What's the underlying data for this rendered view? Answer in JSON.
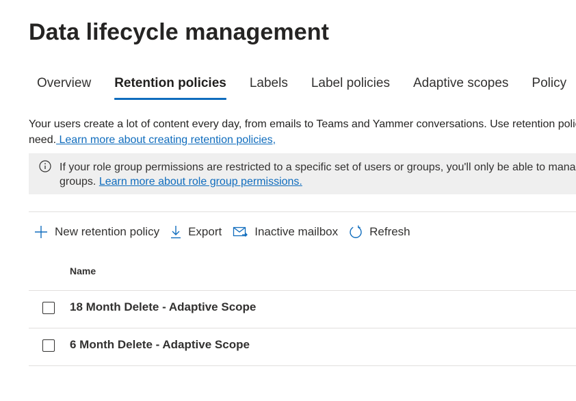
{
  "header": {
    "title": "Data lifecycle management"
  },
  "tabs": [
    {
      "label": "Overview",
      "active": false
    },
    {
      "label": "Retention policies",
      "active": true
    },
    {
      "label": "Labels",
      "active": false
    },
    {
      "label": "Label policies",
      "active": false
    },
    {
      "label": "Adaptive scopes",
      "active": false
    },
    {
      "label": "Policy",
      "active": false
    }
  ],
  "description": {
    "text_line1": "Your users create a lot of content every day, from emails to Teams and Yammer conversations. Use retention policies to retain the content you need.",
    "text_line2": "need.",
    "link": " Learn more about creating retention policies,"
  },
  "banner": {
    "text_line1": "If your role group permissions are restricted to a specific set of users or groups, you'll only be able to manage policies for those users or groups.",
    "text_line2": "groups. ",
    "link": "Learn more about role group permissions."
  },
  "toolbar": {
    "new_label": "New retention policy",
    "export_label": "Export",
    "inactive_label": "Inactive mailbox",
    "refresh_label": "Refresh"
  },
  "table": {
    "columns": [
      "Name"
    ],
    "rows": [
      {
        "name": "18 Month Delete - Adaptive Scope"
      },
      {
        "name": "6 Month Delete - Adaptive Scope"
      }
    ]
  },
  "colors": {
    "accent": "#0f6cbd",
    "banner_bg": "#efefef",
    "divider": "#e1dfdd"
  }
}
